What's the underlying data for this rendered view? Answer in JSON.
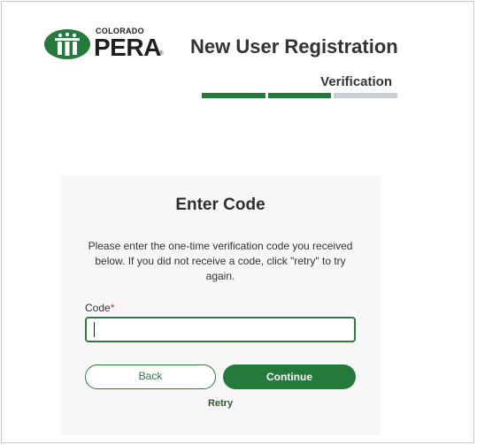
{
  "brand": {
    "logo_top": "COLORADO",
    "logo_main": "PERA",
    "logo_reg": "®",
    "green": "#237a3a",
    "gray": "#c9ced3"
  },
  "header": {
    "title": "New User Registration",
    "step_label": "Verification",
    "progress": {
      "total_steps": 3,
      "completed_steps": 2
    }
  },
  "card": {
    "title": "Enter Code",
    "description": "Please enter the one-time verification code you received below. If you did not receive a code, click \"retry\" to try again.",
    "code_field": {
      "label": "Code",
      "required_marker": "*",
      "value": "",
      "placeholder": ""
    },
    "back_label": "Back",
    "continue_label": "Continue",
    "retry_label": "Retry"
  }
}
